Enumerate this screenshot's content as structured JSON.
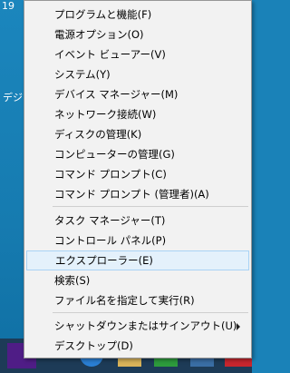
{
  "desktop": {
    "top_text": "19",
    "side_text": "デジ"
  },
  "menu": {
    "items": [
      {
        "label": "プログラムと機能(F)"
      },
      {
        "label": "電源オプション(O)"
      },
      {
        "label": "イベント ビューアー(V)"
      },
      {
        "label": "システム(Y)"
      },
      {
        "label": "デバイス マネージャー(M)"
      },
      {
        "label": "ネットワーク接続(W)"
      },
      {
        "label": "ディスクの管理(K)"
      },
      {
        "label": "コンピューターの管理(G)"
      },
      {
        "label": "コマンド プロンプト(C)"
      },
      {
        "label": "コマンド プロンプト (管理者)(A)"
      },
      {
        "label": "タスク マネージャー(T)"
      },
      {
        "label": "コントロール パネル(P)"
      },
      {
        "label": "エクスプローラー(E)"
      },
      {
        "label": "検索(S)"
      },
      {
        "label": "ファイル名を指定して実行(R)"
      },
      {
        "label": "シャットダウンまたはサインアウト(U)"
      },
      {
        "label": "デスクトップ(D)"
      }
    ]
  },
  "taskbar": {
    "icons": [
      "start-icon",
      "internet-explorer-icon",
      "file-explorer-icon",
      "store-icon",
      "app-icon",
      "app-icon"
    ]
  }
}
